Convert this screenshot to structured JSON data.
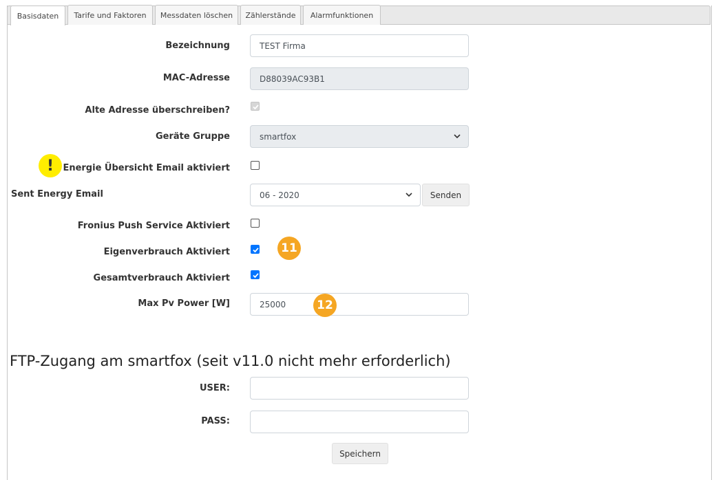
{
  "tabs": [
    {
      "label": "Basisdaten"
    },
    {
      "label": "Tarife und Faktoren"
    },
    {
      "label": "Messdaten löschen"
    },
    {
      "label": "Zählerstände"
    },
    {
      "label": "Alarmfunktionen"
    }
  ],
  "form": {
    "bezeichnung": {
      "label": "Bezeichnung",
      "value": "TEST Firma"
    },
    "mac": {
      "label": "MAC-Adresse",
      "value": "D88039AC93B1"
    },
    "alte_adresse": {
      "label": "Alte Adresse überschreiben?",
      "checked": true
    },
    "geraete_gruppe": {
      "label": "Geräte Gruppe",
      "value": "smartfox"
    },
    "energie_email": {
      "label": "Energie Übersicht Email aktiviert",
      "checked": false
    },
    "sent_energy": {
      "label": "Sent Energy Email",
      "value": "06 - 2020",
      "button": "Senden"
    },
    "fronius": {
      "label": "Fronius Push Service Aktiviert",
      "checked": false
    },
    "eigenverbrauch": {
      "label": "Eigenverbrauch Aktiviert",
      "checked": true
    },
    "gesamtverbrauch": {
      "label": "Gesamtverbrauch Aktiviert",
      "checked": true
    },
    "max_pv": {
      "label": "Max Pv Power [W]",
      "value": "25000"
    }
  },
  "ftp": {
    "heading": "FTP-Zugang am smartfox (seit v11.0 nicht mehr erforderlich)",
    "user_label": "USER:",
    "user_value": "",
    "pass_label": "PASS:",
    "pass_value": "",
    "save_button": "Speichern"
  },
  "annotations": {
    "warning": "!",
    "badge_11": "11",
    "badge_12": "12"
  },
  "colors": {
    "badge": "#f5a623",
    "warning": "#ffed00",
    "checkbox_checked": "#0075ff"
  }
}
